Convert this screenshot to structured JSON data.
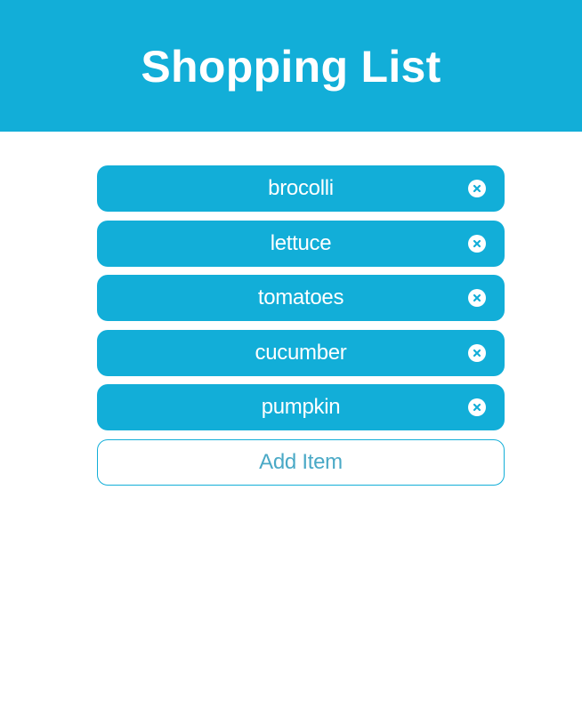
{
  "header": {
    "title": "Shopping List"
  },
  "items": [
    {
      "label": "brocolli",
      "remove_icon": "close-circle-icon"
    },
    {
      "label": "lettuce",
      "remove_icon": "close-circle-icon"
    },
    {
      "label": "tomatoes",
      "remove_icon": "close-circle-icon"
    },
    {
      "label": "cucumber",
      "remove_icon": "close-circle-icon"
    },
    {
      "label": "pumpkin",
      "remove_icon": "close-circle-icon"
    }
  ],
  "add_button": {
    "label": "Add Item"
  },
  "colors": {
    "accent": "#12aed8",
    "text_on_accent": "#ffffff",
    "add_label": "#4aa9c6"
  }
}
